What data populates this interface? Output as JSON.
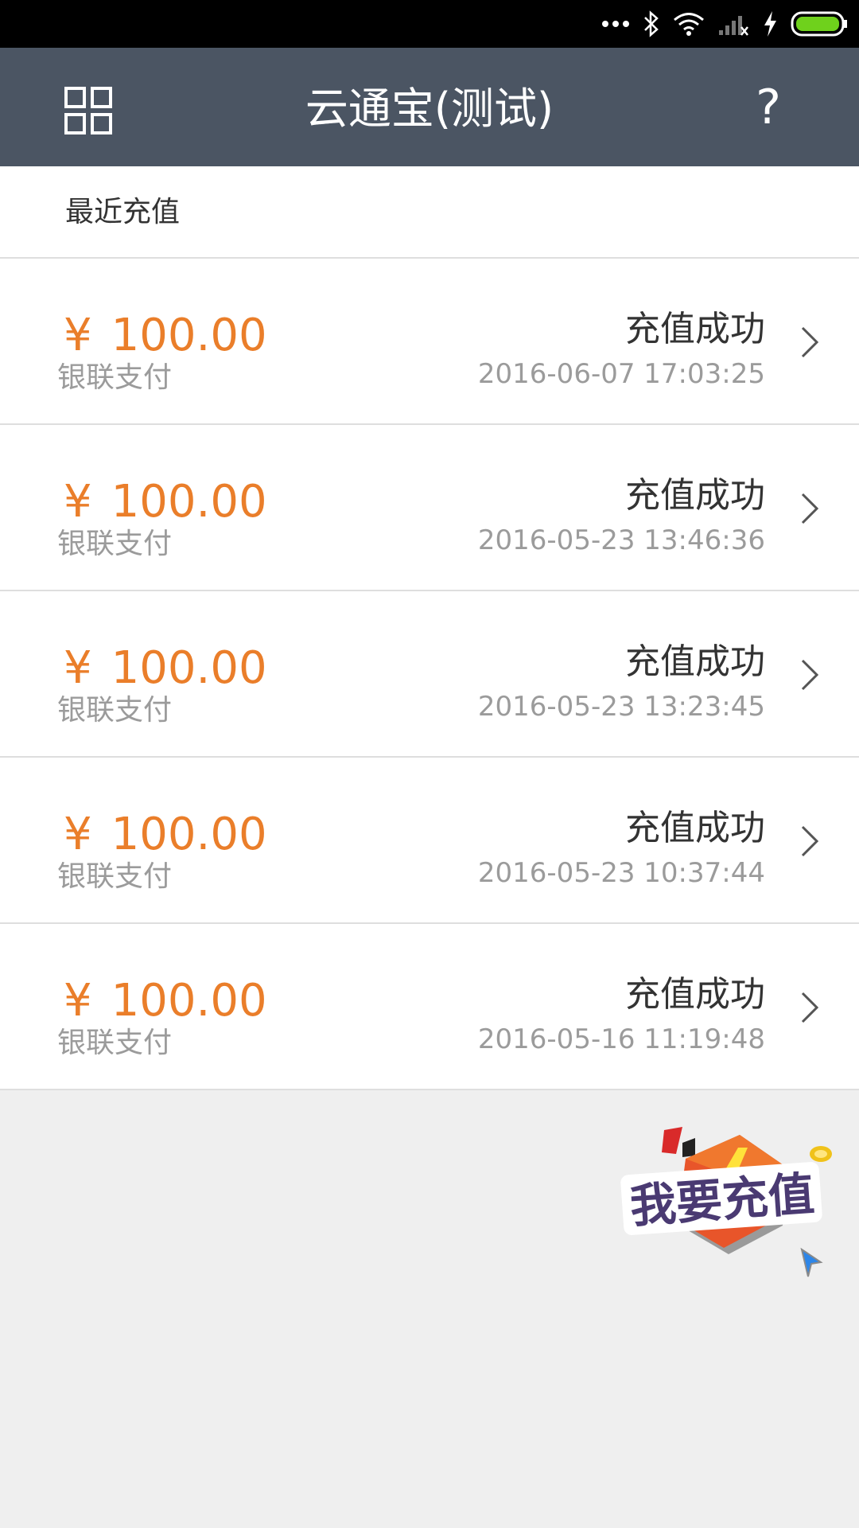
{
  "status_bar": {
    "icons": [
      "more-dots-icon",
      "bluetooth-icon",
      "wifi-icon",
      "signal-icon",
      "charging-icon",
      "battery-icon"
    ]
  },
  "header": {
    "title": "云通宝(测试)",
    "menu_icon": "grid-icon",
    "help_label": "?"
  },
  "section": {
    "title": "最近充值"
  },
  "records": [
    {
      "currency": "¥",
      "amount": "100.00",
      "method": "银联支付",
      "status": "充值成功",
      "time": "2016-06-07 17:03:25"
    },
    {
      "currency": "¥",
      "amount": "100.00",
      "method": "银联支付",
      "status": "充值成功",
      "time": "2016-05-23 13:46:36"
    },
    {
      "currency": "¥",
      "amount": "100.00",
      "method": "银联支付",
      "status": "充值成功",
      "time": "2016-05-23 13:23:45"
    },
    {
      "currency": "¥",
      "amount": "100.00",
      "method": "银联支付",
      "status": "充值成功",
      "time": "2016-05-23 10:37:44"
    },
    {
      "currency": "¥",
      "amount": "100.00",
      "method": "银联支付",
      "status": "充值成功",
      "time": "2016-05-16 11:19:48"
    }
  ],
  "recharge_button": {
    "label": "我要充值"
  },
  "colors": {
    "header_bg": "#4b5563",
    "amount": "#ea7e2a",
    "badge_orange": "#e8552a",
    "badge_purple": "#4a3a72"
  }
}
